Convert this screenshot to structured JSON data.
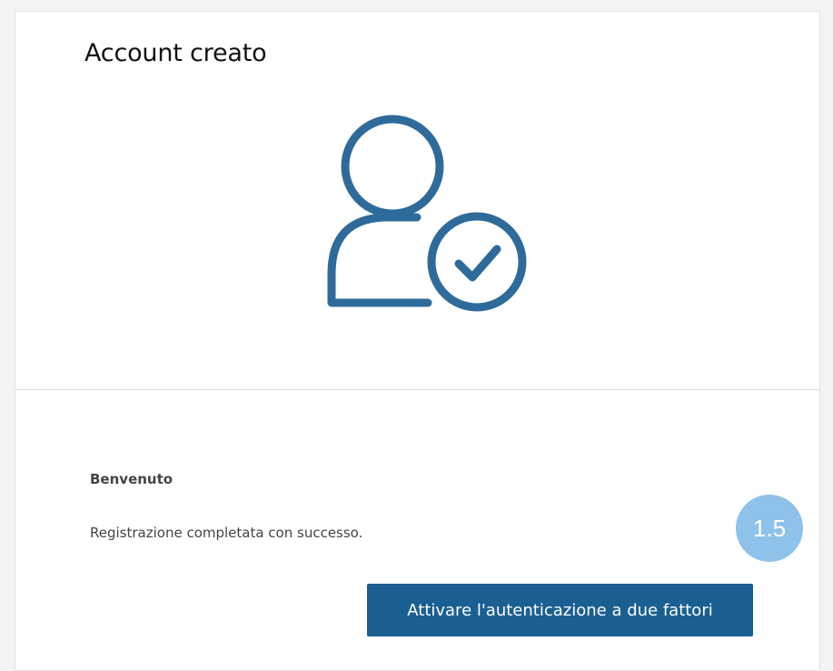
{
  "card": {
    "title": "Account creato",
    "icon": "user-check-icon",
    "welcome_heading": "Benvenuto",
    "message": "Registrazione completata con successo.",
    "primary_button_label": "Attivare l'autenticazione a due fattori"
  },
  "step_badge": {
    "label": "1.5"
  },
  "colors": {
    "accent": "#1a5f92",
    "icon_stroke": "#2f6b9a",
    "badge_bg": "#8ec2ea",
    "page_bg": "#f3f3f3",
    "card_bg": "#ffffff"
  }
}
